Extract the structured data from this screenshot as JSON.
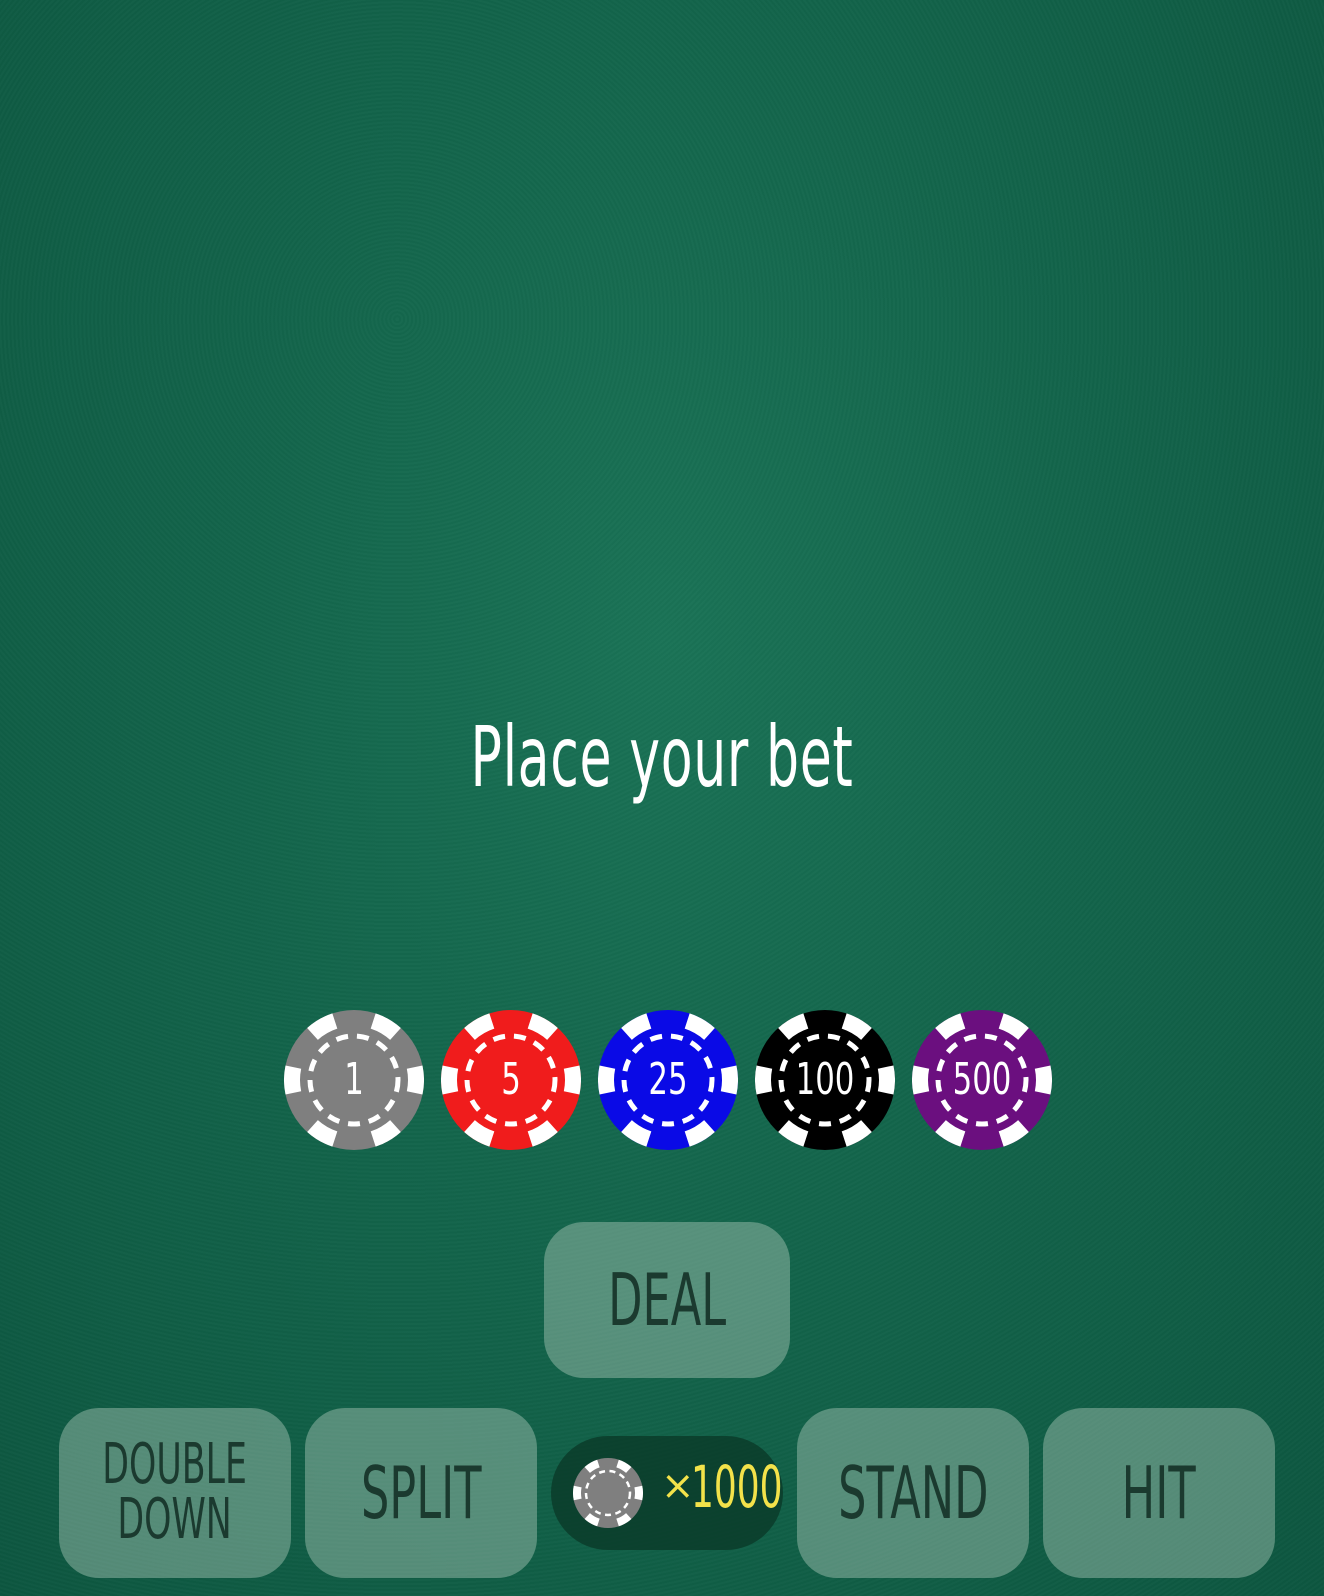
{
  "message": "Place your bet",
  "chips": [
    {
      "value": "1",
      "color": "#7f7f7f"
    },
    {
      "value": "5",
      "color": "#f01c1c"
    },
    {
      "value": "25",
      "color": "#0a0ae6"
    },
    {
      "value": "100",
      "color": "#000000"
    },
    {
      "value": "500",
      "color": "#6b0f7f"
    }
  ],
  "buttons": {
    "deal": "DEAL",
    "double_down": "DOUBLE\nDOWN",
    "split": "SPLIT",
    "stand": "STAND",
    "hit": "HIT"
  },
  "bank": {
    "chip_icon": "gray-chip-icon",
    "times": "×",
    "amount": "1000",
    "amount_color": "#f3e24a"
  }
}
